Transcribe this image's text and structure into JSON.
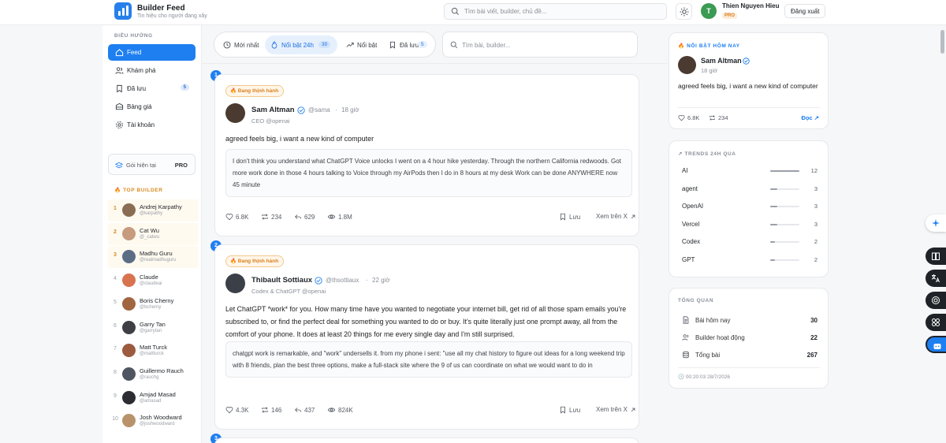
{
  "app": {
    "brand": "Builder Feed",
    "tagline": "Tin hiệu cho người đang xây",
    "search_placeholder": "Tìm bài viết, builder, chủ đề...",
    "user_initial": "T",
    "user_name": "Thien Nguyen Hieu",
    "user_badge": "PRO",
    "logout": "Đăng xuất"
  },
  "sidebar": {
    "nav_title": "ĐIỀU HƯỚNG",
    "items": [
      {
        "label": "Feed",
        "icon": "home-icon"
      },
      {
        "label": "Khám phá",
        "icon": "users-icon"
      },
      {
        "label": "Đã lưu",
        "icon": "bookmark-icon",
        "count": "5"
      },
      {
        "label": "Bảng giá",
        "icon": "grid-icon"
      },
      {
        "label": "Tài khoản",
        "icon": "gear-icon"
      }
    ],
    "plan_label": "Gói hiện tại",
    "plan_value": "PRO",
    "top_title": "TOP BUILDER",
    "builders": [
      {
        "rank": "1",
        "name": "Andrej Karpathy",
        "handle": "@karpathy",
        "color": "#8a6d52"
      },
      {
        "rank": "2",
        "name": "Cat Wu",
        "handle": "@_catwu",
        "color": "#c79b7e"
      },
      {
        "rank": "3",
        "name": "Madhu Guru",
        "handle": "@realmadhuguru",
        "color": "#5c6e86"
      },
      {
        "rank": "4",
        "name": "Claude",
        "handle": "@claudeai",
        "color": "#d8734f"
      },
      {
        "rank": "5",
        "name": "Boris Cherny",
        "handle": "@bcherny",
        "color": "#a0663f"
      },
      {
        "rank": "6",
        "name": "Garry Tan",
        "handle": "@garrytan",
        "color": "#3e3f44"
      },
      {
        "rank": "7",
        "name": "Matt Turck",
        "handle": "@mattturck",
        "color": "#9c5a3e"
      },
      {
        "rank": "8",
        "name": "Guillermo Rauch",
        "handle": "@rauchg",
        "color": "#4f5661"
      },
      {
        "rank": "9",
        "name": "Amjad Masad",
        "handle": "@amasad",
        "color": "#2c2d33"
      },
      {
        "rank": "10",
        "name": "Josh Woodward",
        "handle": "@joshwoodward",
        "color": "#b8926a"
      }
    ]
  },
  "feed": {
    "tabs": [
      {
        "label": "Mới nhất"
      },
      {
        "label": "Nổi bật 24h",
        "count": "30"
      },
      {
        "label": "Nổi bật"
      },
      {
        "label": "Đã lưu",
        "count": "5"
      }
    ],
    "search_placeholder": "Tìm bài, builder...",
    "posts": [
      {
        "number": "1",
        "badge": "Đang thịnh hành",
        "author": "Sam Altman",
        "handle": "@sama",
        "time": "18 giờ",
        "role": "CEO @openai",
        "text": "agreed feels big, i want a new kind of computer",
        "quote": "I don't think you understand what ChatGPT Voice unlocks I went on a 4 hour hike yesterday. Through the northern California redwoods. Got more work done in those 4 hours talking to Voice through my AirPods then I do in 8 hours at my desk Work can be done ANYWHERE now 45 minute",
        "likes": "6.8K",
        "reposts": "234",
        "replies": "629",
        "views": "1.8M",
        "save": "Lưu",
        "view_on_x": "Xem trên X"
      },
      {
        "number": "2",
        "badge": "Đang thịnh hành",
        "author": "Thibault Sottiaux",
        "handle": "@thsottiaux",
        "time": "22 giờ",
        "role": "Codex & ChatGPT @openai",
        "text": "Let ChatGPT *work* for you. How many time have you wanted to negotiate your internet bill, get rid of all those spam emails you're subscribed to, or find the perfect deal for something you wanted to do or buy. It's quite literally just one prompt away, all from the comfort of your phone. It does at least 20 things for me every single day and I'm still surprised.",
        "quote": "chatgpt work is remarkable, and \"work\" undersells it. from my phone i sent: \"use all my chat history to figure out ideas for a long weekend trip with 8 friends, plan the best three options, make a full-stack site where the 9 of us can coordinate on what we would want to do in",
        "likes": "4.3K",
        "reposts": "146",
        "replies": "437",
        "views": "824K",
        "save": "Lưu",
        "view_on_x": "Xem trên X"
      }
    ],
    "next_number": "3"
  },
  "highlight": {
    "title": "NỔI BẬT HÔM NAY",
    "author": "Sam Altman",
    "time": "18 giờ",
    "text": "agreed feels big, i want a new kind of computer",
    "likes": "6.8K",
    "reposts": "234",
    "read": "Đọc"
  },
  "trends": {
    "title": "TRENDS 24H QUA",
    "items": [
      {
        "name": "AI",
        "value": "12",
        "fraction": 1.0
      },
      {
        "name": "agent",
        "value": "3",
        "fraction": 0.25
      },
      {
        "name": "OpenAI",
        "value": "3",
        "fraction": 0.25
      },
      {
        "name": "Vercel",
        "value": "3",
        "fraction": 0.25
      },
      {
        "name": "Codex",
        "value": "2",
        "fraction": 0.17
      },
      {
        "name": "GPT",
        "value": "2",
        "fraction": 0.17
      }
    ]
  },
  "overview": {
    "title": "TỔNG QUAN",
    "rows": [
      {
        "label": "Bài hôm nay",
        "value": "30"
      },
      {
        "label": "Builder hoạt động",
        "value": "22"
      },
      {
        "label": "Tổng bài",
        "value": "267"
      }
    ],
    "timestamp": "00:20:03 28/7/2026"
  },
  "colors": {
    "accent": "#1e7ff0",
    "trending": "#d9801d",
    "success": "#3a9b52"
  }
}
